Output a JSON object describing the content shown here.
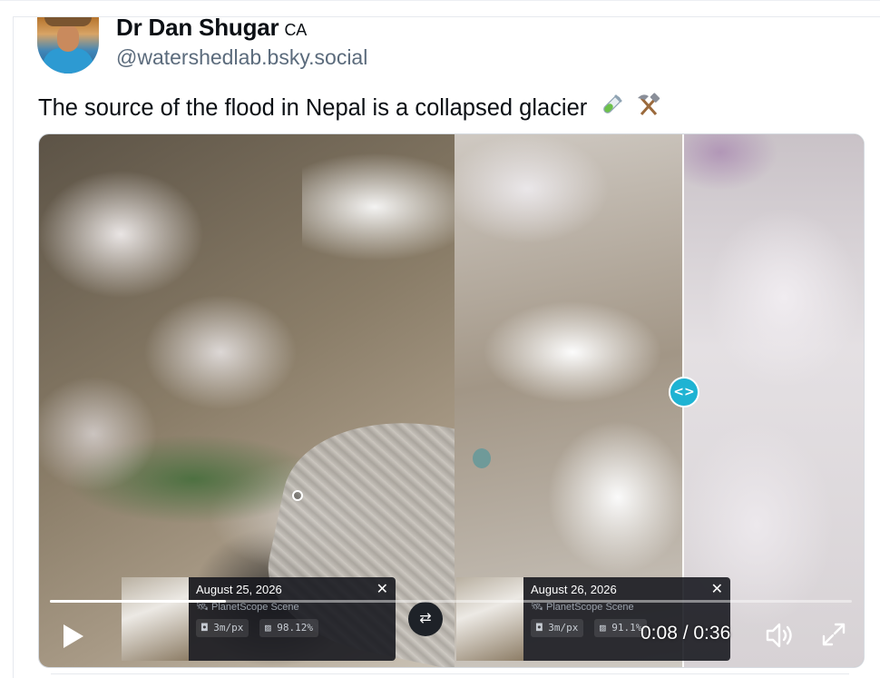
{
  "author": {
    "name": "Dr Dan Shugar",
    "country_tag": "CA",
    "handle": "@watershedlab.bsky.social"
  },
  "post": {
    "text": "The source of the flood in Nepal is a collapsed glacier",
    "emojis": [
      "test-tube-emoji",
      "hammer-and-pick-emoji"
    ]
  },
  "video": {
    "icons": {
      "play": "play-icon",
      "swap": "swap-arrows-icon",
      "volume": "volume-icon",
      "fullscreen": "fullscreen-icon",
      "compare_handle": "compare-slider-icon"
    },
    "progress": 0.22,
    "current_time": "0:08",
    "duration": "0:36",
    "time_display": "0:08 / 0:36",
    "compare_handle_label": "<>",
    "left_scene": {
      "date": "August 25, 2026",
      "source": "PlanetScope Scene",
      "resolution": "3m/px",
      "coverage": "98.12%",
      "close": "✕"
    },
    "right_scene": {
      "date": "August 26, 2026",
      "source": "PlanetScope Scene",
      "resolution": "3m/px",
      "coverage": "91.1%",
      "close": "✕"
    },
    "accent_color": "#1eb3d3"
  }
}
